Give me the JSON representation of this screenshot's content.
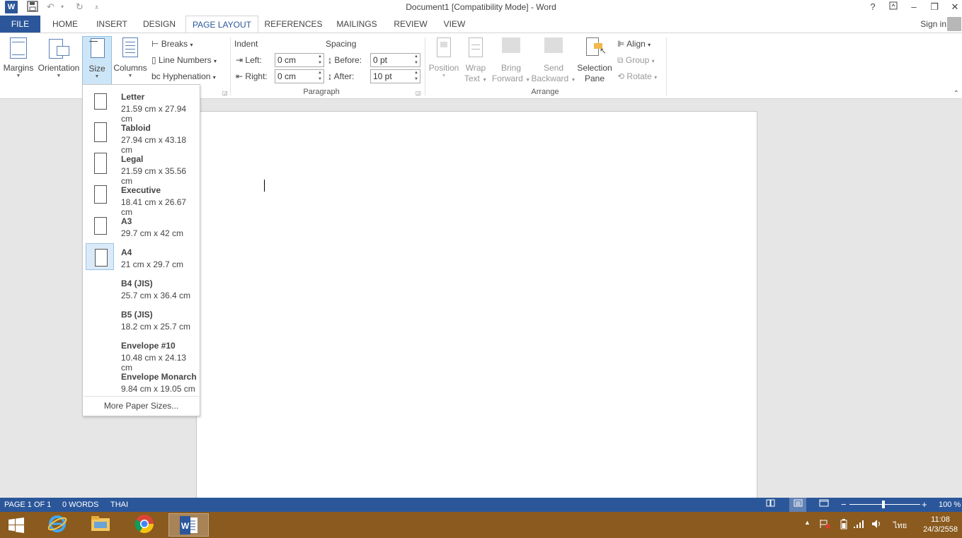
{
  "window": {
    "title": "Document1 [Compatibility Mode] - Word",
    "app_icon": "W",
    "help": "?",
    "minimize": "–",
    "maximize": "❐",
    "close": "✕"
  },
  "tabs": {
    "file": "FILE",
    "items": [
      "HOME",
      "INSERT",
      "DESIGN",
      "PAGE LAYOUT",
      "REFERENCES",
      "MAILINGS",
      "REVIEW",
      "VIEW"
    ],
    "active": "PAGE LAYOUT",
    "sign_in": "Sign in"
  },
  "ribbon": {
    "page_setup": {
      "margins": "Margins",
      "orientation": "Orientation",
      "size": "Size",
      "columns": "Columns",
      "breaks": "Breaks",
      "line_numbers": "Line Numbers",
      "hyphenation": "Hyphenation"
    },
    "paragraph": {
      "indent_heading": "Indent",
      "spacing_heading": "Spacing",
      "left_label": "Left:",
      "left_value": "0 cm",
      "right_label": "Right:",
      "right_value": "0 cm",
      "before_label": "Before:",
      "before_value": "0 pt",
      "after_label": "After:",
      "after_value": "10 pt",
      "group_label": "Paragraph"
    },
    "arrange": {
      "position": "Position",
      "wrap_text_1": "Wrap",
      "wrap_text_2": "Text",
      "bring_forward_1": "Bring",
      "bring_forward_2": "Forward",
      "send_backward_1": "Send",
      "send_backward_2": "Backward",
      "selection_pane_1": "Selection",
      "selection_pane_2": "Pane",
      "align": "Align",
      "group": "Group",
      "rotate": "Rotate",
      "group_label": "Arrange"
    }
  },
  "size_menu": {
    "items": [
      {
        "name": "Letter",
        "dims": "21.59 cm x 27.94 cm"
      },
      {
        "name": "Tabloid",
        "dims": "27.94 cm x 43.18 cm"
      },
      {
        "name": "Legal",
        "dims": "21.59 cm x 35.56 cm"
      },
      {
        "name": "Executive",
        "dims": "18.41 cm x 26.67 cm"
      },
      {
        "name": "A3",
        "dims": "29.7 cm x 42 cm"
      },
      {
        "name": "A4",
        "dims": "21 cm x 29.7 cm"
      },
      {
        "name": "B4 (JIS)",
        "dims": "25.7 cm x 36.4 cm"
      },
      {
        "name": "B5 (JIS)",
        "dims": "18.2 cm x 25.7 cm"
      },
      {
        "name": "Envelope #10",
        "dims": "10.48 cm x 24.13 cm"
      },
      {
        "name": "Envelope Monarch",
        "dims": "9.84 cm x 19.05 cm"
      }
    ],
    "selected": "A4",
    "more": "More Paper Sizes..."
  },
  "status": {
    "page": "PAGE 1 OF 1",
    "words": "0 WORDS",
    "language": "THAI",
    "zoom": "100 %",
    "minus": "−",
    "plus": "+"
  },
  "taskbar": {
    "time": "11:08",
    "date": "24/3/2558",
    "ime": "ไทย"
  },
  "colors": {
    "accent": "#2b579a",
    "taskbar": "#8a5a1f"
  }
}
